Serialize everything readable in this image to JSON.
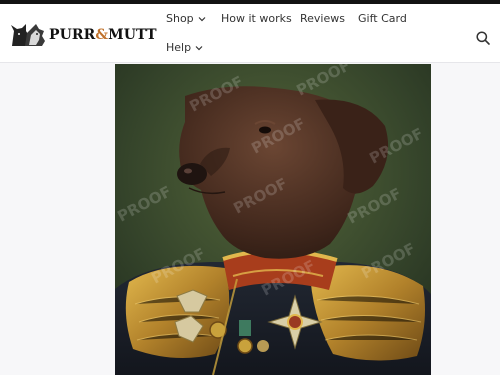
{
  "brand": {
    "name_part1": "PURR",
    "ampersand": "&",
    "name_part2": "MUTT",
    "accent_color": "#c0722c"
  },
  "nav": {
    "shop": "Shop",
    "how_it_works": "How it works",
    "reviews": "Reviews",
    "gift_card": "Gift Card",
    "help": "Help"
  },
  "icons": {
    "search": "search-icon",
    "dropdown": "chevron-down-icon",
    "logo": "cat-dog-logo-icon"
  },
  "product": {
    "watermark": "PROOF"
  },
  "colors": {
    "topbar": "#121212",
    "header_bg": "#ffffff",
    "page_bg": "#f7f7f9",
    "nav_text": "#333333"
  }
}
